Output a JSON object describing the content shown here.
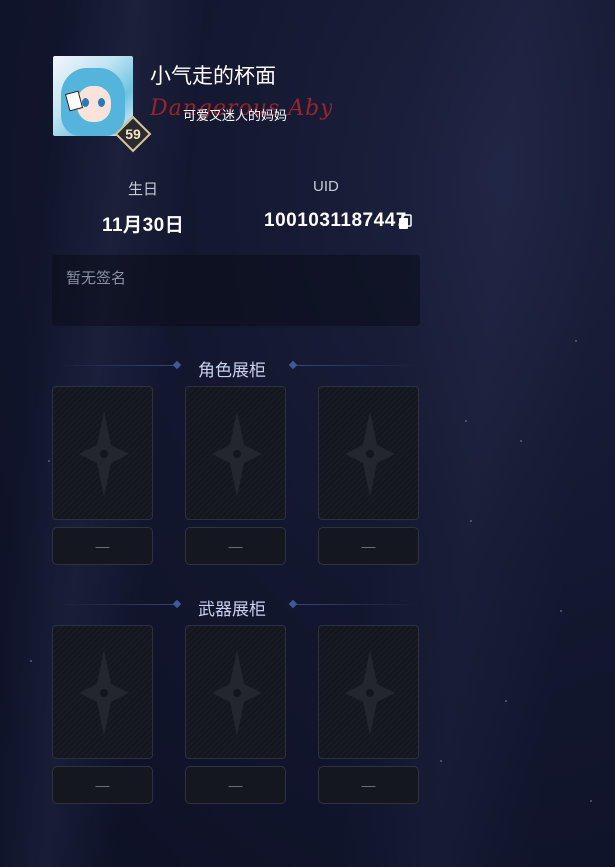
{
  "profile": {
    "username": "小气走的杯面",
    "level": "59",
    "title_text": "可爱又迷人的妈妈",
    "title_deco": "Dangerous Abyss"
  },
  "info": {
    "birthday_label": "生日",
    "birthday_value": "11月30日",
    "uid_label": "UID",
    "uid_value": "1001031187447"
  },
  "signature": {
    "placeholder": "暂无签名"
  },
  "character_showcase": {
    "title": "角色展柜",
    "slots": [
      {
        "label": "—"
      },
      {
        "label": "—"
      },
      {
        "label": "—"
      }
    ]
  },
  "weapon_showcase": {
    "title": "武器展柜",
    "slots": [
      {
        "label": "—"
      },
      {
        "label": "—"
      },
      {
        "label": "—"
      }
    ]
  },
  "colors": {
    "accent": "#3d5a9a",
    "background": "#141830",
    "deco": "#b0262c"
  }
}
